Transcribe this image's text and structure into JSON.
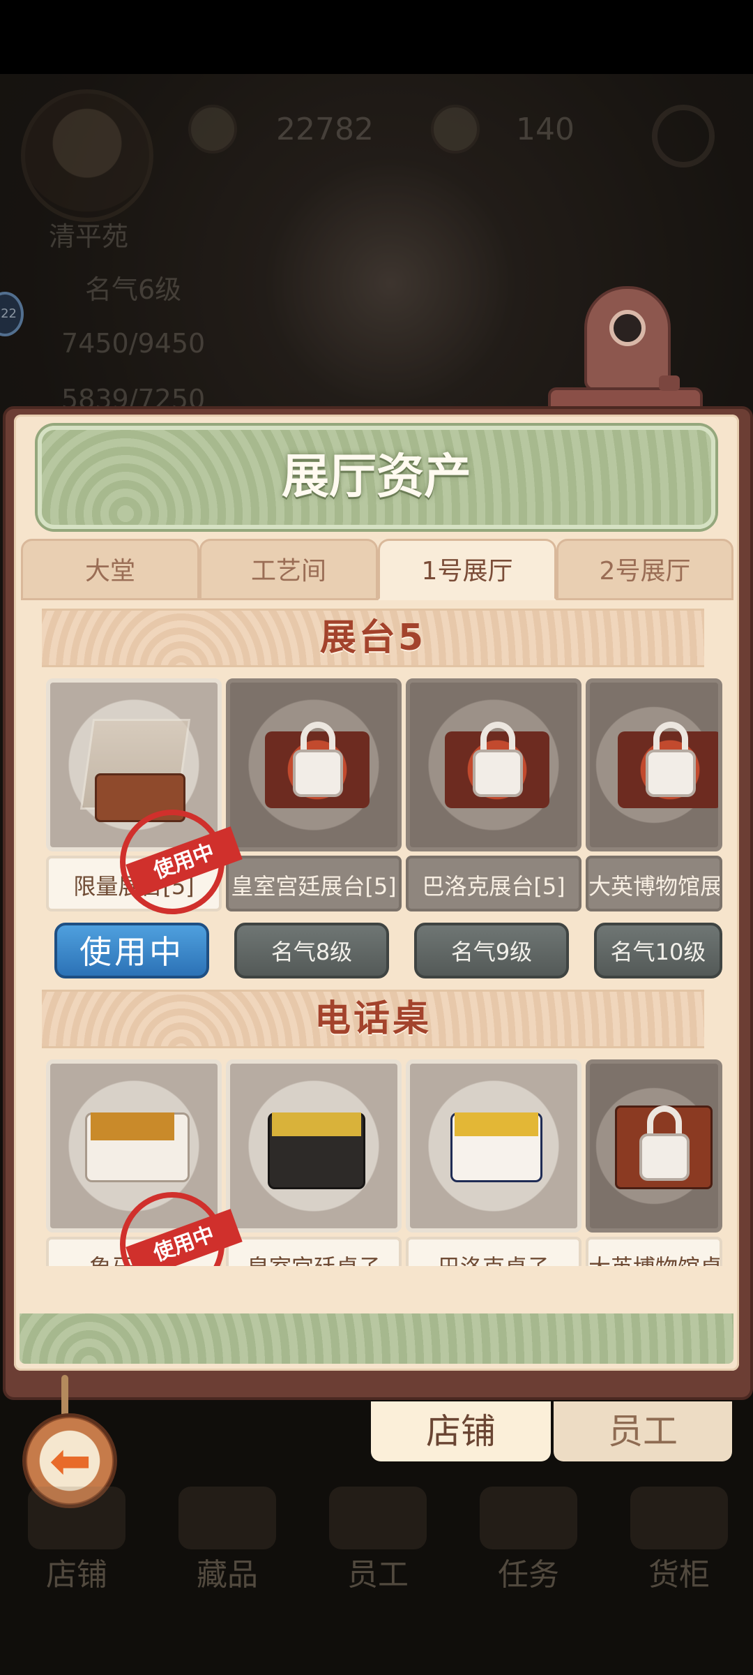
{
  "hud": {
    "name": "清平苑",
    "fame": "名气6级",
    "gold": "22782",
    "gems": "140",
    "stat1": "7450/9450",
    "stat2": "5839/7250",
    "badge": "22"
  },
  "panel": {
    "title": "展厅资产",
    "tabs": [
      "大堂",
      "工艺间",
      "1号展厅",
      "2号展厅"
    ],
    "active_tab_index": 2
  },
  "section_displays": {
    "title": "展台5",
    "items": [
      {
        "name": "限量展台[5]",
        "status": "使用中",
        "locked": false,
        "in_use": true
      },
      {
        "name": "皇室宫廷展台[5]",
        "status": "名气8级",
        "locked": true
      },
      {
        "name": "巴洛克展台[5]",
        "status": "名气9级",
        "locked": true
      },
      {
        "name": "大英博物馆展台",
        "status": "名气10级",
        "locked": true
      }
    ]
  },
  "section_phone_desk": {
    "title": "电话桌",
    "items": [
      {
        "name": "象牙桌子",
        "in_use": true,
        "locked": false
      },
      {
        "name": "皇室宫廷桌子",
        "locked": false
      },
      {
        "name": "巴洛克桌子",
        "locked": false
      },
      {
        "name": "大英博物馆桌子",
        "locked": true
      }
    ]
  },
  "stamp_label": "使用中",
  "bottom_tabs": {
    "shop": "店铺",
    "staff": "员工"
  },
  "nav": [
    "店铺",
    "藏品",
    "员工",
    "任务",
    "货柜"
  ],
  "colors": {
    "accent_title": "#a3432c",
    "in_use_button": "#2c72b6",
    "locked_button": "#545a58",
    "stamp": "#d0302c"
  },
  "icons": [
    "back-arrow-icon",
    "lock-icon",
    "display-stand-icon",
    "desk-icon",
    "coin-icon",
    "gem-icon"
  ]
}
